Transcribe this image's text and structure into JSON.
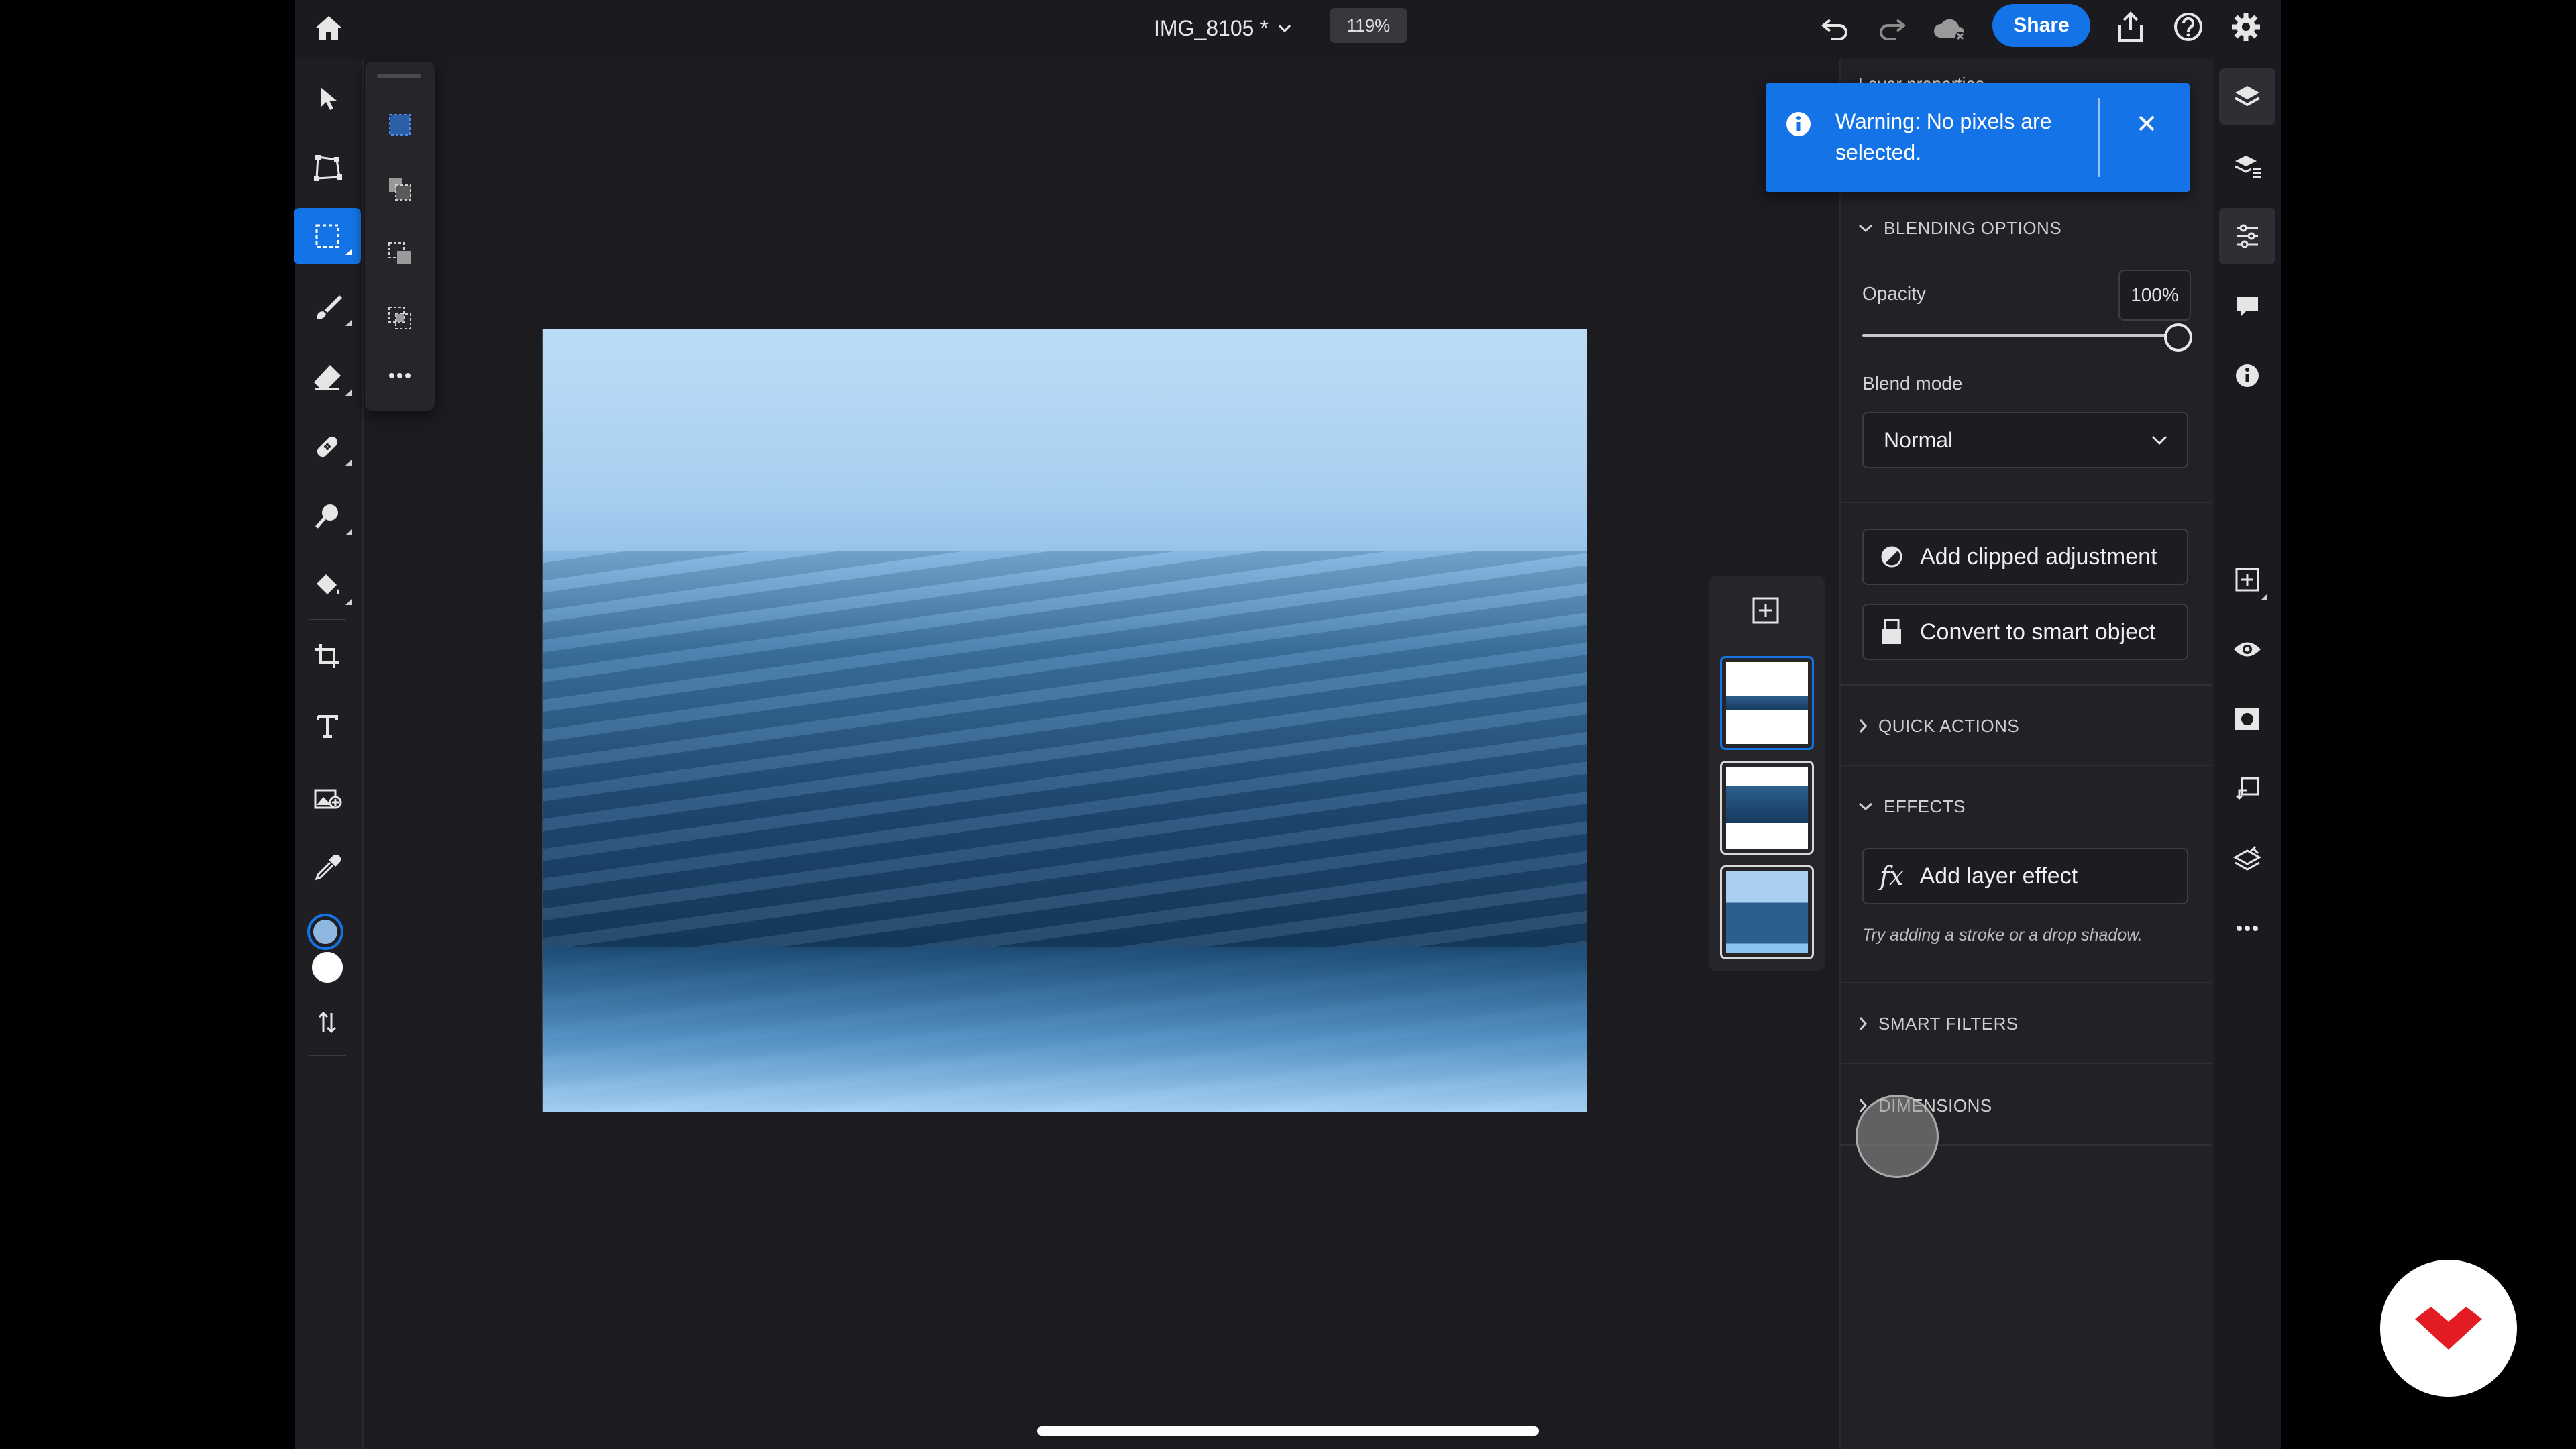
{
  "header": {
    "document_title": "IMG_8105 *",
    "zoom_level": "119%",
    "share_label": "Share"
  },
  "toolbar": {
    "tools": [
      {
        "name": "move-tool",
        "icon": "arrow-pointer-icon"
      },
      {
        "name": "transform-tool",
        "icon": "transform-icon"
      },
      {
        "name": "selection-tool",
        "icon": "marquee-select-icon",
        "active": true
      },
      {
        "name": "brush-tool",
        "icon": "brush-icon"
      },
      {
        "name": "eraser-tool",
        "icon": "eraser-icon"
      },
      {
        "name": "healing-tool",
        "icon": "bandage-icon"
      },
      {
        "name": "clone-tool",
        "icon": "clone-stamp-icon"
      },
      {
        "name": "fill-tool",
        "icon": "paint-bucket-icon"
      },
      {
        "name": "crop-tool",
        "icon": "crop-icon"
      },
      {
        "name": "type-tool",
        "icon": "text-icon"
      },
      {
        "name": "place-image-tool",
        "icon": "place-image-icon"
      },
      {
        "name": "eyedropper-tool",
        "icon": "eyedropper-icon"
      }
    ],
    "foreground_color": "#8fb8e0",
    "background_color": "#ffffff"
  },
  "selection_flyout": {
    "items": [
      "marquee-select-icon",
      "lasso-select-icon",
      "object-select-icon",
      "subject-select-icon",
      "more-icon"
    ]
  },
  "layers_strip": {
    "layer_count": 3,
    "selected_index": 0
  },
  "toast": {
    "message": "Warning: No pixels are selected.",
    "partially_hidden_header": "Layer properties"
  },
  "properties": {
    "blending_options": {
      "header": "BLENDING OPTIONS",
      "opacity_label": "Opacity",
      "opacity_value": "100%",
      "opacity_fraction": 1.0,
      "blend_mode_label": "Blend mode",
      "blend_mode_value": "Normal"
    },
    "actions": {
      "add_clipped_adjustment": "Add clipped adjustment",
      "convert_to_smart_object": "Convert to smart object"
    },
    "quick_actions_header": "QUICK ACTIONS",
    "effects": {
      "header": "EFFECTS",
      "add_layer_effect": "Add layer effect",
      "hint": "Try adding a stroke or a drop shadow."
    },
    "smart_filters_header": "SMART FILTERS",
    "dimensions_header": "DIMENSIONS"
  },
  "colors": {
    "accent": "#1473e6",
    "brand_red": "#e31b23"
  }
}
